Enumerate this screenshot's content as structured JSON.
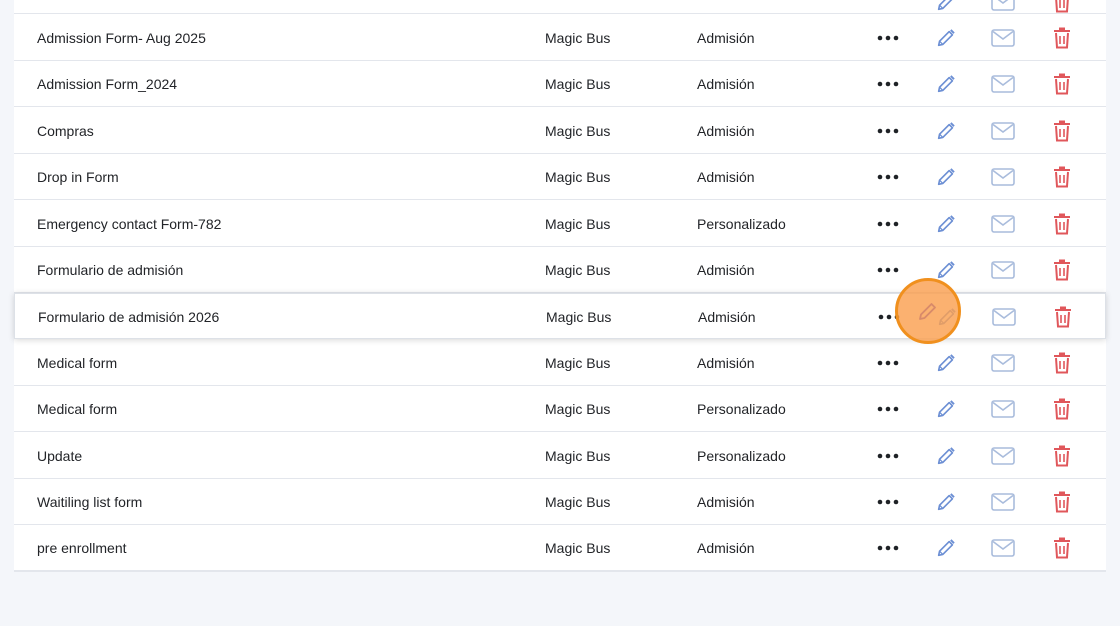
{
  "colors": {
    "edit_icon": "#6c8fd4",
    "mail_icon": "#a9bcdc",
    "delete_icon": "#e0575b",
    "more_icon": "#1f2226",
    "click_indicator": "#f0901e"
  },
  "icons": {
    "more": "more-icon",
    "edit": "pencil-icon",
    "mail": "envelope-icon",
    "delete": "trash-icon"
  },
  "forms": {
    "rows": [
      {
        "name": "Admission Form- Aug 2025",
        "organization": "Magic Bus",
        "type": "Admisión"
      },
      {
        "name": "Admission Form_2024",
        "organization": "Magic Bus",
        "type": "Admisión"
      },
      {
        "name": "Compras",
        "organization": "Magic Bus",
        "type": "Admisión"
      },
      {
        "name": "Drop in Form",
        "organization": "Magic Bus",
        "type": "Admisión"
      },
      {
        "name": "Emergency contact Form-782",
        "organization": "Magic Bus",
        "type": "Personalizado"
      },
      {
        "name": "Formulario de admisión",
        "organization": "Magic Bus",
        "type": "Admisión"
      },
      {
        "name": "Formulario de admisión 2026",
        "organization": "Magic Bus",
        "type": "Admisión"
      },
      {
        "name": "Medical form",
        "organization": "Magic Bus",
        "type": "Admisión"
      },
      {
        "name": "Medical form",
        "organization": "Magic Bus",
        "type": "Personalizado"
      },
      {
        "name": "Update",
        "organization": "Magic Bus",
        "type": "Personalizado"
      },
      {
        "name": "Waitiling list form",
        "organization": "Magic Bus",
        "type": "Admisión"
      },
      {
        "name": "pre enrollment",
        "organization": "Magic Bus",
        "type": "Admisión"
      }
    ]
  }
}
